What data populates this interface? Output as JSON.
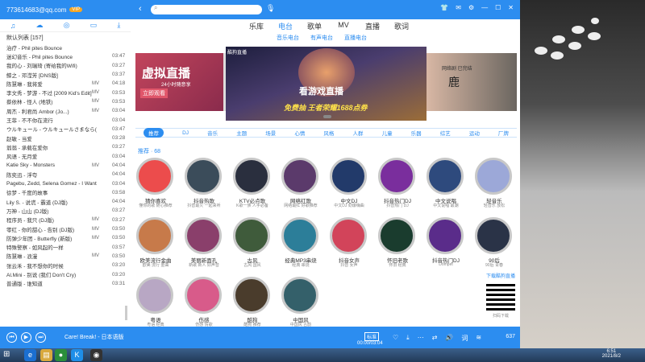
{
  "titlebar": {
    "account": "773614683@qq.com",
    "vip": "VIP"
  },
  "left_toolbar": {
    "icons": [
      "music-note-icon",
      "cloud-icon",
      "gamepad-icon",
      "device-icon",
      "download-icon"
    ]
  },
  "playlist": {
    "header": "默认列表 [157]",
    "songs": [
      {
        "title": "治疗 - Phil pites Bounce",
        "mv": "",
        "duration": ""
      },
      {
        "title": "迷幻音乐 - Phil pites Bounce",
        "mv": "",
        "duration": "03:47"
      },
      {
        "title": "我的心 - 刘瑞琦 (寄给我的Wifi)",
        "mv": "",
        "duration": "03:27"
      },
      {
        "title": "鲸之 - 邓滢芳 [DNS版]",
        "mv": "",
        "duration": "03:37"
      },
      {
        "title": "陈慧琳 - 我将爱",
        "mv": "MV",
        "duration": "04:18"
      },
      {
        "title": "李文秀 - 梦游 - 不过 [2009 Kid's Edit]",
        "mv": "MV",
        "duration": "03:53"
      },
      {
        "title": "蔡依林 - 怪人 (地铁)",
        "mv": "MV",
        "duration": "03:53"
      },
      {
        "title": "周杰 - 利君尚 Ambor (Jo...)",
        "mv": "MV",
        "duration": "03:04"
      },
      {
        "title": "王菲 - 不不你在流行",
        "mv": "",
        "duration": "03:04"
      },
      {
        "title": "ウルキュール - ウルキュールさまなら(M)",
        "mv": "",
        "duration": "03:47"
      },
      {
        "title": "赵敏 - 当爱",
        "mv": "",
        "duration": "03:28"
      },
      {
        "title": "翁翁 - 承载在爱你",
        "mv": "",
        "duration": "03:27"
      },
      {
        "title": "风语 - 无月爱",
        "mv": "",
        "duration": "03:04"
      },
      {
        "title": "Katie Sky - Monsters",
        "mv": "MV",
        "duration": "04:04"
      },
      {
        "title": "陈奕迅 - 浮夸",
        "mv": "",
        "duration": "04:04"
      },
      {
        "title": "Pagebu, Zedd, Selena Gomez - I Want You",
        "mv": "",
        "duration": "03:04"
      },
      {
        "title": "徐梦 - 千度的故事",
        "mv": "",
        "duration": "03:58"
      },
      {
        "title": "Lily S. - 说谎 - 霸道 (DJ版)",
        "mv": "",
        "duration": "04:04"
      },
      {
        "title": "万神 - 山山 (DJ版)",
        "mv": "",
        "duration": "03:27"
      },
      {
        "title": "程序员 - 我只 (DJ版)",
        "mv": "MV",
        "duration": "03:27"
      },
      {
        "title": "零红 - 你的甜心 - 告别 (DJ版)",
        "mv": "MV",
        "duration": "03:50"
      },
      {
        "title": "防弹少年团 - Butterfly (新版)",
        "mv": "MV",
        "duration": "03:50"
      },
      {
        "title": "特殊警察 - 如风起的一样",
        "mv": "",
        "duration": "03:57"
      },
      {
        "title": "陈慧琳 - 浪漫",
        "mv": "MV",
        "duration": "03:50"
      },
      {
        "title": "张云禾 - 我不想你的时候",
        "mv": "",
        "duration": "03:20"
      },
      {
        "title": "Al.Mini - 别说 (我们 Don't Cry)",
        "mv": "",
        "duration": "03:20"
      },
      {
        "title": "普通版 - 谁知道",
        "mv": "",
        "duration": "03:31"
      }
    ]
  },
  "top_tabs": [
    {
      "label": "乐库",
      "active": false
    },
    {
      "label": "电台",
      "active": true
    },
    {
      "label": "歌单",
      "active": false
    },
    {
      "label": "MV",
      "active": false
    },
    {
      "label": "直播",
      "active": false
    },
    {
      "label": "歌词",
      "active": false
    }
  ],
  "sub_tabs": [
    "音乐电台",
    "有声电台",
    "直播电台"
  ],
  "banner": {
    "left_title": "虚拟直播",
    "left_sub": "24小时随意享",
    "left_btn": "立即观看",
    "center_logo": "酷狗直播",
    "center_title": "看游戏直播",
    "center_sub": "免费抽 王者荣耀1688点券",
    "right_sub": "网络剧 已完结",
    "right_title": "鹿"
  },
  "categories": [
    {
      "label": "推荐",
      "active": true
    },
    {
      "label": "DJ"
    },
    {
      "label": "音乐"
    },
    {
      "label": "主题"
    },
    {
      "label": "场景"
    },
    {
      "label": "心情"
    },
    {
      "label": "风格"
    },
    {
      "label": "人群"
    },
    {
      "label": "儿童"
    },
    {
      "label": "乐器"
    },
    {
      "label": "综艺"
    },
    {
      "label": "运动"
    },
    {
      "label": "厂牌"
    }
  ],
  "recommend_label": "推荐 · 68",
  "stations": [
    {
      "name": "猜你喜欢",
      "sub": "懂你的歌 随心推荐",
      "color": "#ec4c4c"
    },
    {
      "name": "抖音热歌",
      "sub": "抖音最火 一起来听",
      "color": "#3b4c5a"
    },
    {
      "name": "KTV必点歌",
      "sub": "K歌一族 人手必备",
      "color": "#2a2f3e"
    },
    {
      "name": "网络红歌",
      "sub": "网络最红 好歌推荐",
      "color": "#5b3a6b"
    },
    {
      "name": "中文DJ",
      "sub": "中文DJ 劲爆嗨曲",
      "color": "#223a6a"
    },
    {
      "name": "抖音热门DJ",
      "sub": "抖音热门 DJ",
      "color": "#7a2e9d"
    },
    {
      "name": "中文说唱",
      "sub": "中文说唱 最潮",
      "color": "#2e4a7d"
    },
    {
      "name": "轻音乐",
      "sub": "轻音乐 放松",
      "color": "#9ca8d8"
    },
    {
      "name": "欧美流行金曲",
      "sub": "欧美 流行 金曲",
      "color": "#c77a4a"
    },
    {
      "name": "美丽新面孔",
      "sub": "新歌 新人 好声音",
      "color": "#8a3f6b"
    },
    {
      "name": "古风",
      "sub": "古风 国风",
      "color": "#3f5b3b"
    },
    {
      "name": "经典MP3串烧",
      "sub": "经典 串烧",
      "color": "#2c7e99"
    },
    {
      "name": "抖音女声",
      "sub": "抖音 女声",
      "color": "#d2445a"
    },
    {
      "name": "怀旧老歌",
      "sub": "怀旧 经典",
      "color": "#1a3c2e"
    },
    {
      "name": "抖音热门DJ",
      "sub": "Dompet",
      "color": "#5a2c8a"
    },
    {
      "name": "90后",
      "sub": "90后 青春",
      "color": "#2a3347"
    },
    {
      "name": "粤语",
      "sub": "粤语 经典",
      "color": "#b8a7c4"
    },
    {
      "name": "伤感",
      "sub": "伤感 情歌",
      "color": "#d85b8a"
    },
    {
      "name": "酷狗",
      "sub": "酷狗 推荐",
      "color": "#4a3c2c"
    },
    {
      "name": "中国风",
      "sub": "中国风 古韵",
      "color": "#34606a"
    }
  ],
  "qr": {
    "top": "下载酷狗直播",
    "bottom": "扫码下载"
  },
  "player": {
    "song": "Care! Break! - 日本语版",
    "quality": "标准",
    "time": "00:00/03:04",
    "count": "637"
  },
  "taskbar": {
    "start": "⊞",
    "clock_time": "6:51",
    "clock_date": "2021/8/2"
  }
}
